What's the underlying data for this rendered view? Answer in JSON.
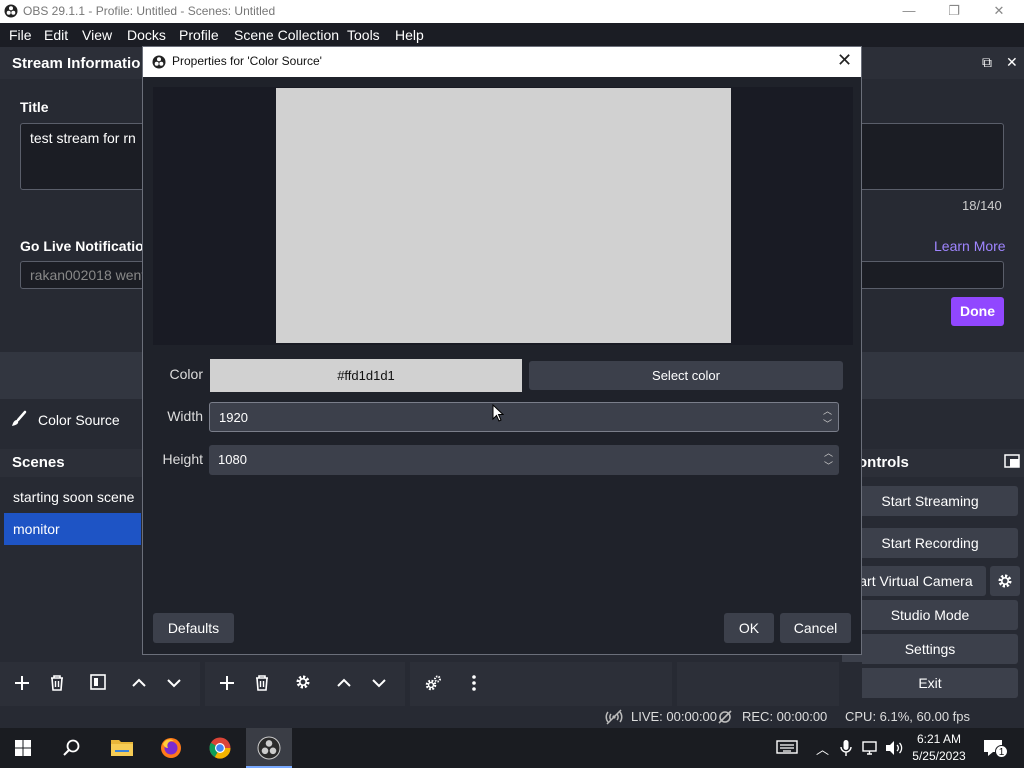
{
  "window": {
    "title": "OBS 29.1.1 - Profile: Untitled - Scenes: Untitled",
    "min_glyph": "—",
    "max_glyph": "❐",
    "close_glyph": "✕"
  },
  "menu": [
    "File",
    "Edit",
    "View",
    "Docks",
    "Profile",
    "Scene Collection",
    "Tools",
    "Help"
  ],
  "stream_info": {
    "dock_title": "Stream Informatio",
    "title_label": "Title",
    "title_value": "test stream for rn",
    "counter": "18/140",
    "golive_label": "Go Live Notification",
    "golive_value": "rakan002018 went",
    "learn_more": "Learn More",
    "done": "Done",
    "undock_glyph": "⧉",
    "close_glyph": "✕"
  },
  "sources_toolbar": {
    "source_name": "Color Source"
  },
  "scenes": {
    "title": "Scenes",
    "items": [
      {
        "label": "starting soon scene",
        "selected": false
      },
      {
        "label": "monitor",
        "selected": true
      }
    ]
  },
  "controls": {
    "title": "ontrols",
    "start_streaming": "Start Streaming",
    "start_recording": "Start Recording",
    "start_virtual_camera": "tart Virtual Camera",
    "studio_mode": "Studio Mode",
    "settings": "Settings",
    "exit": "Exit"
  },
  "statusbar": {
    "live": "LIVE: 00:00:00",
    "rec": "REC: 00:00:00",
    "cpu": "CPU: 6.1%, 60.00 fps"
  },
  "taskbar": {
    "time": "6:21 AM",
    "date": "5/25/2023",
    "notification_count": "1"
  },
  "dialog": {
    "title": "Properties for 'Color Source'",
    "preview_color": "#d1d1d1",
    "color_label": "Color",
    "color_value": "#ffd1d1d1",
    "select_color": "Select color",
    "width_label": "Width",
    "width_value": "1920",
    "height_label": "Height",
    "height_value": "1080",
    "defaults": "Defaults",
    "ok": "OK",
    "cancel": "Cancel",
    "spin_up_glyph": "︿",
    "spin_down_glyph": "﹀"
  },
  "colors": {
    "accent_purple": "#9147ff",
    "selection_blue": "#1e54c5",
    "link_purple": "#9f85ff"
  }
}
